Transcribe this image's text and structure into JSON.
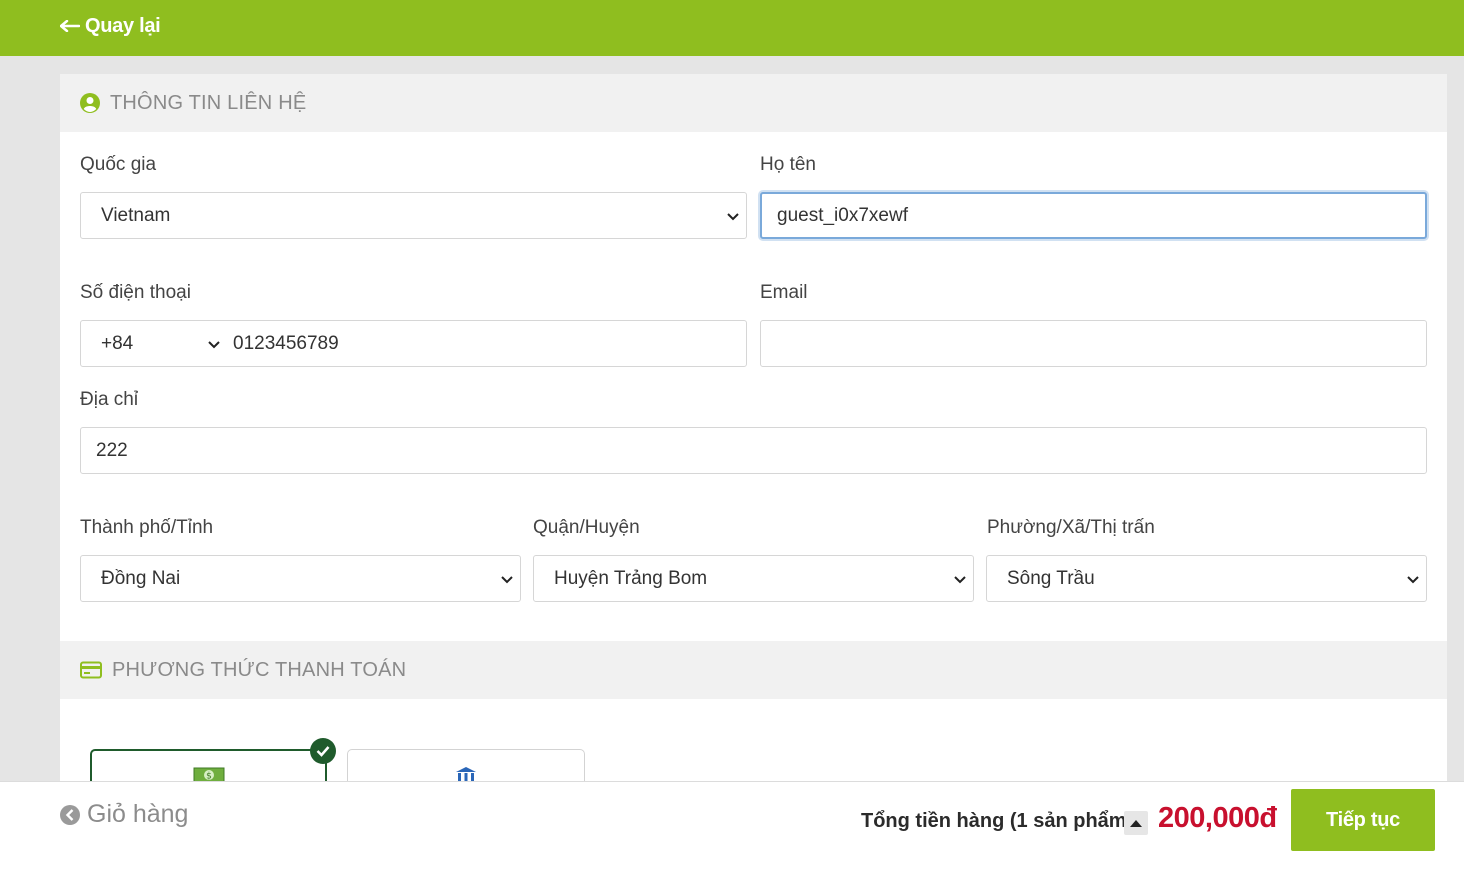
{
  "header": {
    "back_label": "Quay lại"
  },
  "contact": {
    "section_title": "THÔNG TIN LIÊN HỆ",
    "country": {
      "label": "Quốc gia",
      "value": "Vietnam"
    },
    "full_name": {
      "label": "Họ tên",
      "value": "guest_i0x7xewf"
    },
    "phone": {
      "label": "Số điện thoại",
      "code": "+84",
      "number": "0123456789"
    },
    "email": {
      "label": "Email",
      "value": ""
    },
    "address": {
      "label": "Địa chỉ",
      "value": "222"
    },
    "province": {
      "label": "Thành phố/Tỉnh",
      "value": "Đồng Nai"
    },
    "district": {
      "label": "Quận/Huyện",
      "value": "Huyện Trảng Bom"
    },
    "ward": {
      "label": "Phường/Xã/Thị trấn",
      "value": "Sông Trầu"
    }
  },
  "payment": {
    "section_title": "PHƯƠNG THỨC THANH TOÁN",
    "options": [
      {
        "icon": "cash-icon",
        "selected": true
      },
      {
        "icon": "bank-icon",
        "selected": false
      }
    ]
  },
  "footer": {
    "cart_label": "Giỏ hàng",
    "total_label": "Tổng tiền hàng (1 sản phẩm):",
    "total_amount": "200,000đ",
    "continue_label": "Tiếp tục"
  },
  "colors": {
    "brand_green": "#8fbe1f",
    "price_red": "#c8102e",
    "selected_green": "#1f5b2c"
  }
}
